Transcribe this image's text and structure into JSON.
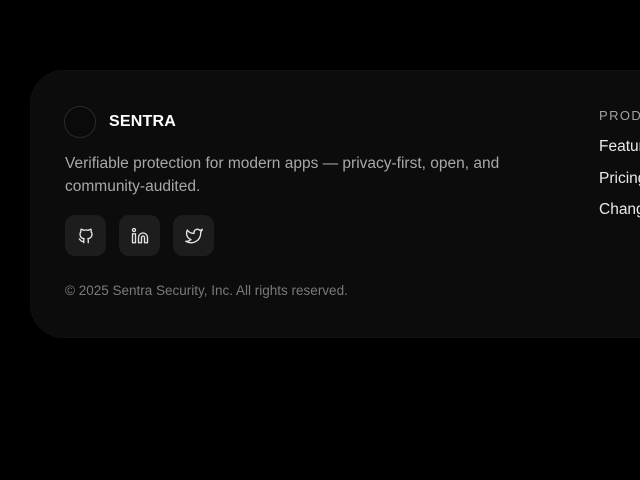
{
  "brand": {
    "name": "SENTRA",
    "tagline": "Verifiable protection for modern apps — privacy-first, open, and community-audited."
  },
  "socials": [
    {
      "icon": "github-icon",
      "label": "GitHub"
    },
    {
      "icon": "linkedin-icon",
      "label": "LinkedIn"
    },
    {
      "icon": "twitter-icon",
      "label": "Twitter"
    }
  ],
  "copyright": "© 2025 Sentra Security, Inc. All rights reserved.",
  "product_column": {
    "heading": "PRODUCT",
    "links": [
      "Features",
      "Pricing",
      "Changelog"
    ]
  },
  "colors": {
    "background": "#000000",
    "card": "#0c0c0c",
    "button": "#1d1d1d",
    "text_primary": "#ffffff",
    "text_muted": "#a8a8a8"
  }
}
